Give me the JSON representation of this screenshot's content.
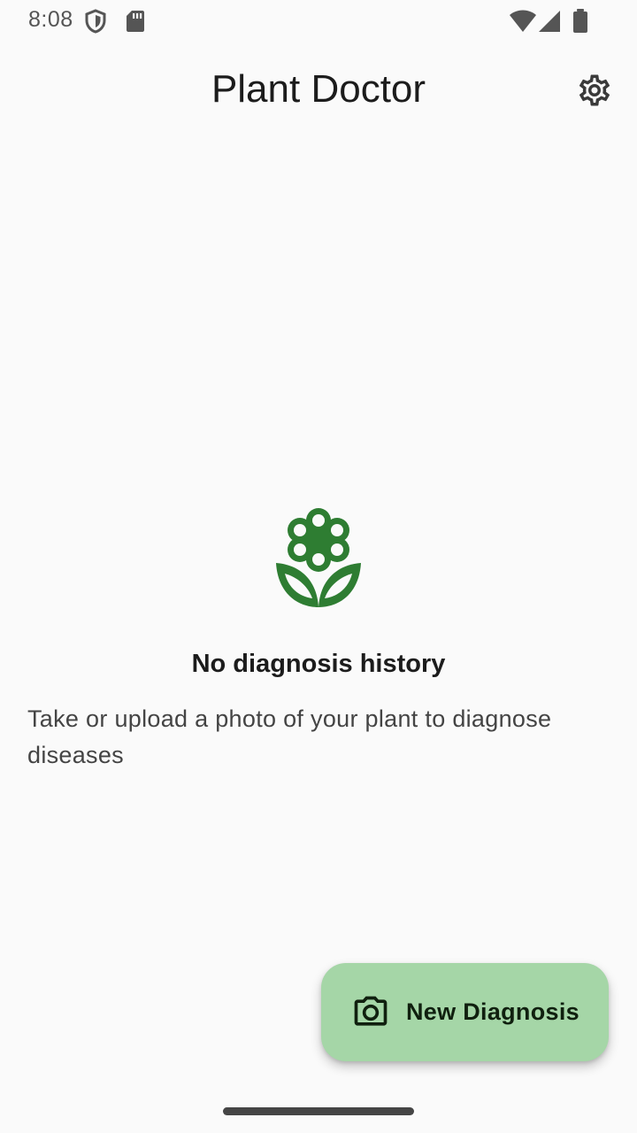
{
  "status_bar": {
    "time": "8:08",
    "icons": [
      "shield-icon",
      "sd-card-icon",
      "wifi-icon",
      "signal-icon",
      "battery-icon"
    ]
  },
  "app_bar": {
    "title": "Plant Doctor",
    "settings_icon": "gear-icon"
  },
  "empty_state": {
    "icon": "flower-icon",
    "title": "No diagnosis history",
    "subtitle": "Take or upload a photo of your plant to diagnose diseases"
  },
  "fab": {
    "icon": "camera-icon",
    "label": "New Diagnosis"
  },
  "colors": {
    "accent": "#2e7d32",
    "fab_background": "#a5d6a7",
    "background": "#fafafa"
  }
}
